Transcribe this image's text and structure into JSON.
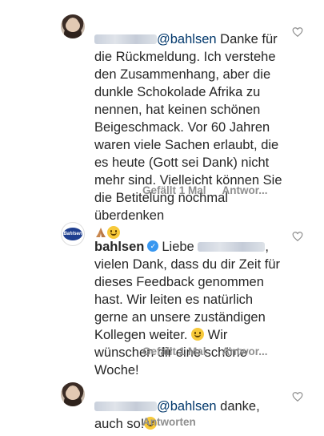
{
  "comments": [
    {
      "mention": "@bahlsen",
      "text_first": " Danke für",
      "text_body": "die Rückmeldung. Ich verstehe den Zusammenhang, aber die dunkle Schokolade Afrika zu nennen, hat keinen schönen Beigeschmack. Vor 60 Jahren waren viele Sachen erlaubt, die es heute (Gott sei Dank) nicht mehr sind. Vielleicht können Sie die Betitelung nochmal überdenken",
      "likes": "Gefällt 1 Mal",
      "reply": "Antwor..."
    },
    {
      "username": "bahlsen",
      "verified_mark": "✓",
      "greeting": "Liebe",
      "text_body": ", vielen Dank, dass du dir Zeit für dieses Feedback genommen hast. Wir leiten es natürlich gerne an unsere zuständigen Kollegen weiter.",
      "text_end": "  Wir wünschen dir eine schöne Woche!",
      "likes": "Gefällt 1 Mal",
      "reply": "Antwor..."
    },
    {
      "mention": "@bahlsen",
      "text_first": " danke,",
      "text_second": "auch so!",
      "reply": "Antworten"
    }
  ],
  "logo_text": "Bahlsen",
  "icons": [
    "heart-icon",
    "verified-icon",
    "smile-emoji",
    "praying-hands-emoji",
    "blush-emoji"
  ]
}
